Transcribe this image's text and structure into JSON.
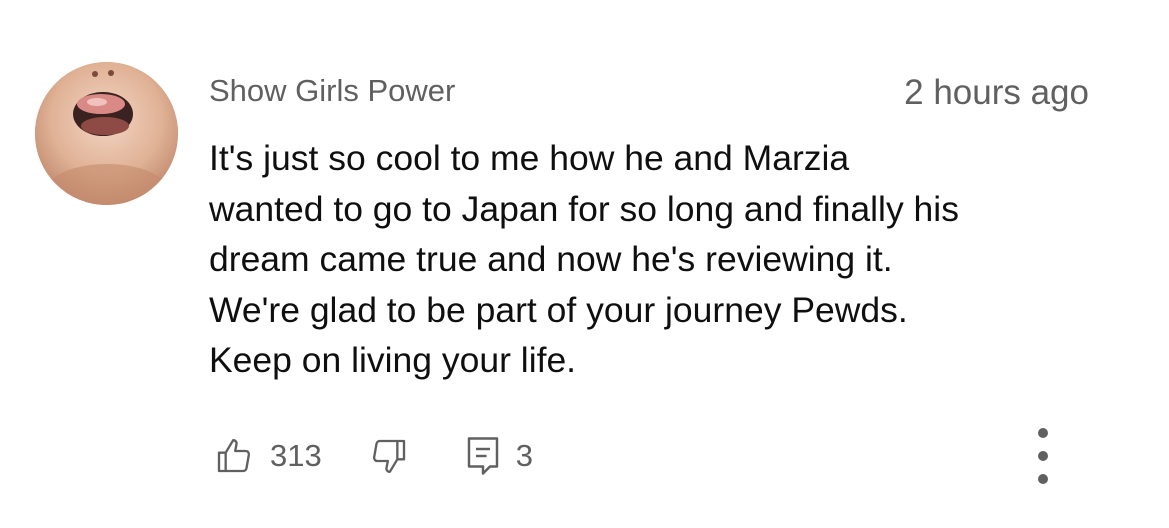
{
  "comment": {
    "author": "Show Girls Power",
    "timestamp": "2 hours ago",
    "text_lines": [
      "It's just so cool to me how he and Marzia",
      "wanted to go to Japan for so long and finally his",
      "dream came true and now he's reviewing it.",
      "We're glad to be part of your journey Pewds.",
      "Keep on living your life."
    ],
    "like_count": "313",
    "reply_count": "3"
  },
  "icons": {
    "like": "thumbs-up-icon",
    "dislike": "thumbs-down-icon",
    "reply": "comment-icon",
    "more": "more-vertical-icon"
  },
  "colors": {
    "text_primary": "#0f0f0f",
    "text_secondary": "#606060"
  }
}
